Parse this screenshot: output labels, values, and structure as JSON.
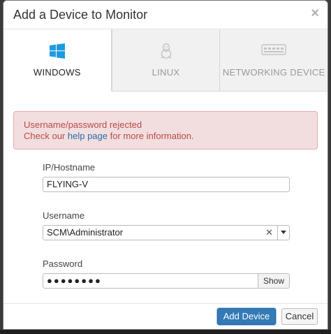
{
  "dialog": {
    "title": "Add a Device to Monitor",
    "close_glyph": "×"
  },
  "tabs": [
    {
      "label": "WINDOWS",
      "icon": "windows-icon",
      "active": true
    },
    {
      "label": "LINUX",
      "icon": "linux-icon",
      "active": false
    },
    {
      "label": "NETWORKING DEVICE",
      "icon": "network-device-icon",
      "active": false
    }
  ],
  "alert": {
    "line1": "Username/password rejected",
    "line2_prefix": "Check our ",
    "line2_link": "help page",
    "line2_suffix": " for more information."
  },
  "form": {
    "hostname": {
      "label": "IP/Hostname",
      "value": "FLYING-V"
    },
    "username": {
      "label": "Username",
      "value": "SCM\\Administrator",
      "clear_glyph": "✕"
    },
    "password": {
      "label": "Password",
      "value": "●●●●●●●●",
      "show_label": "Show"
    }
  },
  "footer": {
    "add_label": "Add Device",
    "cancel_label": "Cancel"
  },
  "colors": {
    "primary": "#337ab7",
    "alert_bg": "#f2dede",
    "alert_text": "#b94a48",
    "link": "#2a6aad"
  }
}
